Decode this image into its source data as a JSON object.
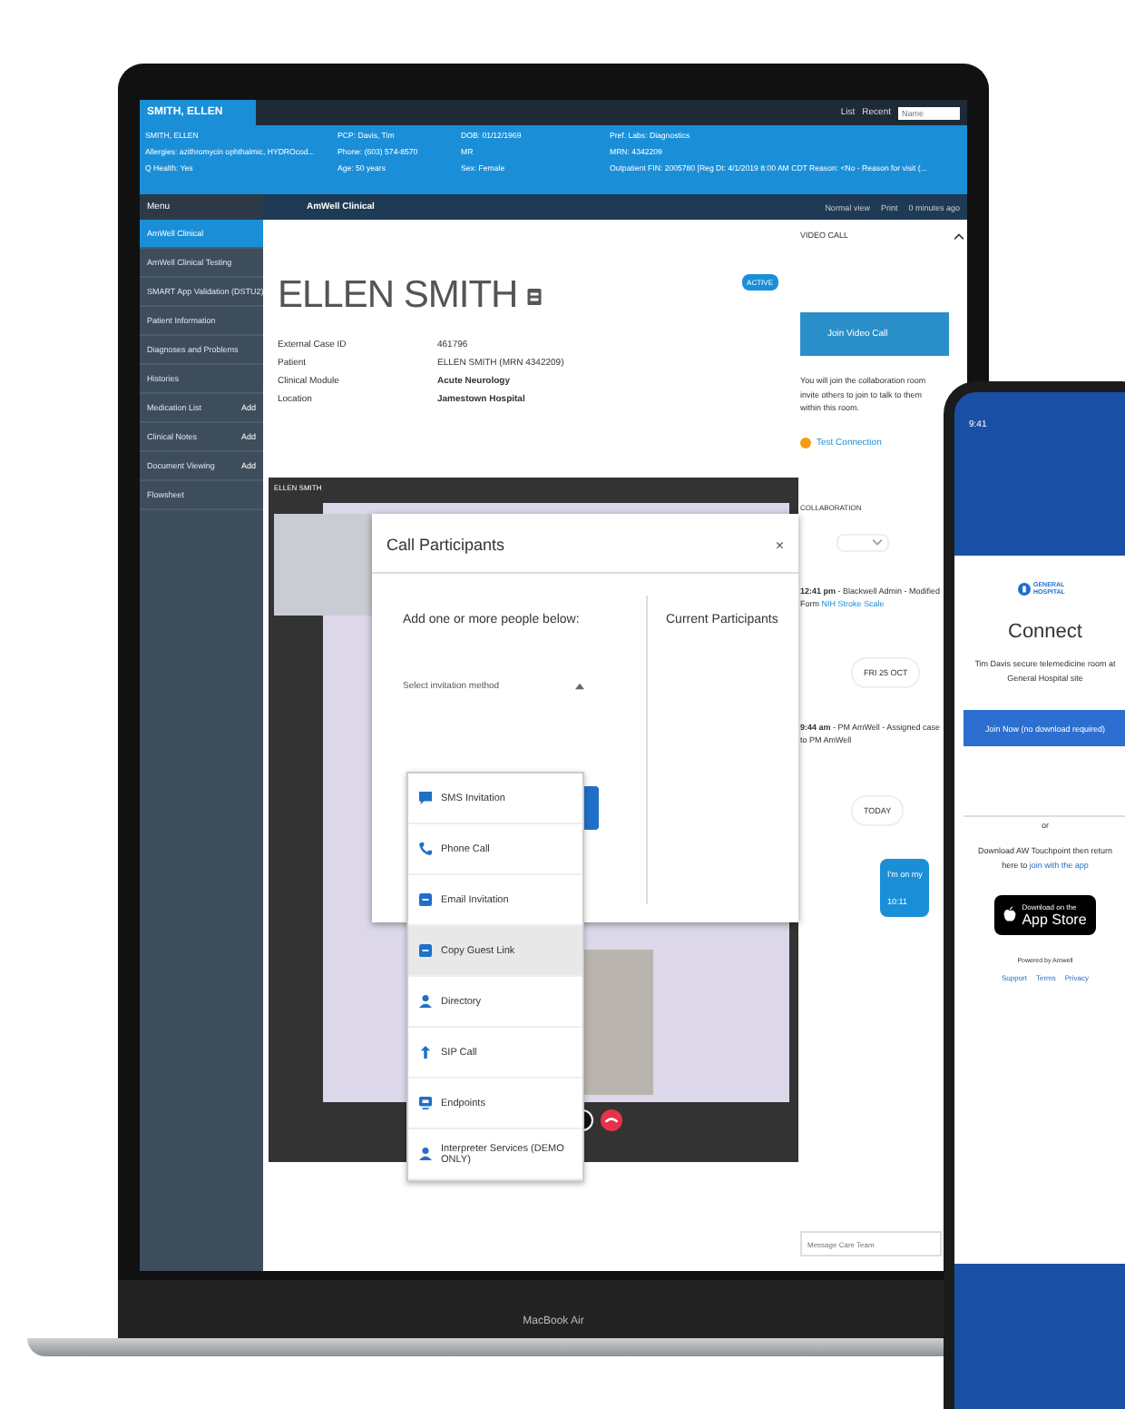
{
  "topbar": {
    "tab": "SMITH, ELLEN",
    "actions": [
      "List",
      "Recent"
    ],
    "search": {
      "placeholder": "Name"
    }
  },
  "banner": [
    [
      "SMITH, ELLEN",
      "Allergies: azithromycin ophthalmic, HYDROcod...",
      "Q Health: Yes"
    ],
    [
      "PCP: Davis, Tim",
      "Phone: (603) 574-8570",
      "Age: 50 years"
    ],
    [
      "DOB: 01/12/1969",
      "MR",
      "Sex: Female"
    ],
    [
      "Pref. Labs: Diagnostics",
      "MRN: 4342209",
      "Outpatient FIN: 2005780 [Reg Dt: 4/1/2019 8:00 AM CDT Reason: <No - Reason for visit (..."
    ]
  ],
  "navbar": {
    "menu": "Menu",
    "breadcrumb": "AmWell Clinical",
    "actions": [
      "Normal view",
      "Print",
      "0 minutes ago"
    ]
  },
  "sidebar": {
    "items": [
      {
        "label": "AmWell Clinical",
        "selected": true
      },
      {
        "label": "AmWell Clinical Testing",
        "selected": false
      },
      {
        "label": "SMART App Validation (DSTU2)",
        "selected": false
      },
      {
        "label": "Patient Information",
        "selected": false
      },
      {
        "label": "Diagnoses and Problems",
        "selected": false
      },
      {
        "label": "Histories",
        "selected": false
      },
      {
        "label": "Medication List",
        "selected": false,
        "action": "Add"
      },
      {
        "label": "Clinical Notes",
        "selected": false,
        "action": "Add"
      },
      {
        "label": "Document Viewing",
        "selected": false,
        "action": "Add"
      },
      {
        "label": "Flowsheet",
        "selected": false
      }
    ]
  },
  "patient": {
    "name": "ELLEN SMITH",
    "status": "ACTIVE",
    "details": [
      {
        "label": "External Case ID",
        "value": "461796",
        "bold": false
      },
      {
        "label": "Patient",
        "value": "ELLEN SMITH   (MRN 4342209)",
        "bold": false
      },
      {
        "label": "Clinical Module",
        "value": "Acute Neurology",
        "bold": true
      },
      {
        "label": "Location",
        "value": "Jamestown Hospital",
        "bold": true
      }
    ]
  },
  "video": {
    "caller": "ELLEN SMITH"
  },
  "dialog": {
    "title": "Call Participants",
    "close": "×",
    "prompt": "Add one or more people below:",
    "select": {
      "placeholder": "Select invitation method"
    },
    "current": "Current Participants",
    "options": [
      {
        "label": "SMS Invitation",
        "kind": "sms",
        "selected": false
      },
      {
        "label": "Phone Call",
        "kind": "phone",
        "selected": false
      },
      {
        "label": "Email Invitation",
        "kind": "email",
        "selected": false
      },
      {
        "label": "Copy Guest Link",
        "kind": "link",
        "selected": true
      },
      {
        "label": "Directory",
        "kind": "person",
        "selected": false
      },
      {
        "label": "SIP Call",
        "kind": "sip",
        "selected": false
      },
      {
        "label": "Endpoints",
        "kind": "endpoint",
        "selected": false
      },
      {
        "label": "Interpreter Services (DEMO ONLY)",
        "kind": "person",
        "selected": false
      }
    ]
  },
  "right_panel": {
    "title": "VIDEO CALL",
    "join": "Join Video Call",
    "info": "You will join the collaboration room invite others to join to talk to them within this room.",
    "test": "Test Connection",
    "section": "COLLABORATION",
    "timeline": [
      {
        "kind": "entry",
        "text": "**12:41 pm** - Blackwell Admin - Modified Form",
        "link": "NIH Stroke Scale"
      },
      {
        "kind": "date",
        "text": "FRI 25 OCT"
      },
      {
        "kind": "entry",
        "text": "**9:44 am** - PM AmWell - Assigned case to PM AmWell"
      },
      {
        "kind": "date",
        "text": "TODAY"
      },
      {
        "kind": "message",
        "text": "I'm on my",
        "time": "10:11"
      }
    ],
    "message": {
      "placeholder": "Message Care Team"
    }
  },
  "laptop": {
    "model": "MacBook Air"
  },
  "phone": {
    "time": "9:41",
    "logo": "GENERAL HOSPITAL",
    "title": "Connect",
    "intro": "Tim Davis secure telemedicine room at General Hospital site",
    "join": "Join Now (no download required)",
    "or": "or",
    "download": "Download AW Touchpoint then return here to",
    "download_link": "join with the app",
    "badge_small": "Download on the",
    "badge": "App Store",
    "powered": "Powered by Amwell",
    "links": [
      "Support",
      "Terms",
      "Privacy"
    ]
  }
}
